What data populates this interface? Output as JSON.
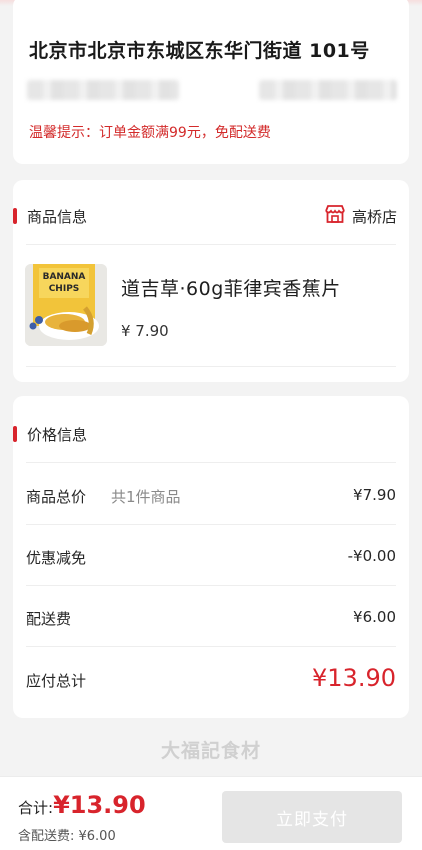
{
  "address": {
    "line": "北京市北京市东城区东华门街道  101号",
    "tip": "温馨提示：订单金额满99元，免配送费"
  },
  "goods_section": {
    "title": "商品信息",
    "store_icon": "store-icon",
    "store_name": "高桥店",
    "item": {
      "name": "道吉草·60g菲律宾香蕉片",
      "price": "¥ 7.90",
      "image_text_1": "BANANA",
      "image_text_2": "CHIPS"
    }
  },
  "price_section": {
    "title": "价格信息",
    "rows": [
      {
        "label": "商品总价",
        "sub": "共1件商品",
        "value": "¥7.90"
      },
      {
        "label": "优惠减免",
        "sub": "",
        "value": "-¥0.00"
      },
      {
        "label": "配送费",
        "sub": "",
        "value": "¥6.00"
      },
      {
        "label": "应付总计",
        "sub": "",
        "value": "¥13.90"
      }
    ]
  },
  "watermark": "大福記食材",
  "bottom_bar": {
    "total_label": "合计:",
    "total_amount": "¥13.90",
    "delivery_note": "含配送费: ¥6.00",
    "pay_button": "立即支付"
  },
  "colors": {
    "accent": "#d8242c",
    "disabled_button": "#e5e5e5"
  }
}
